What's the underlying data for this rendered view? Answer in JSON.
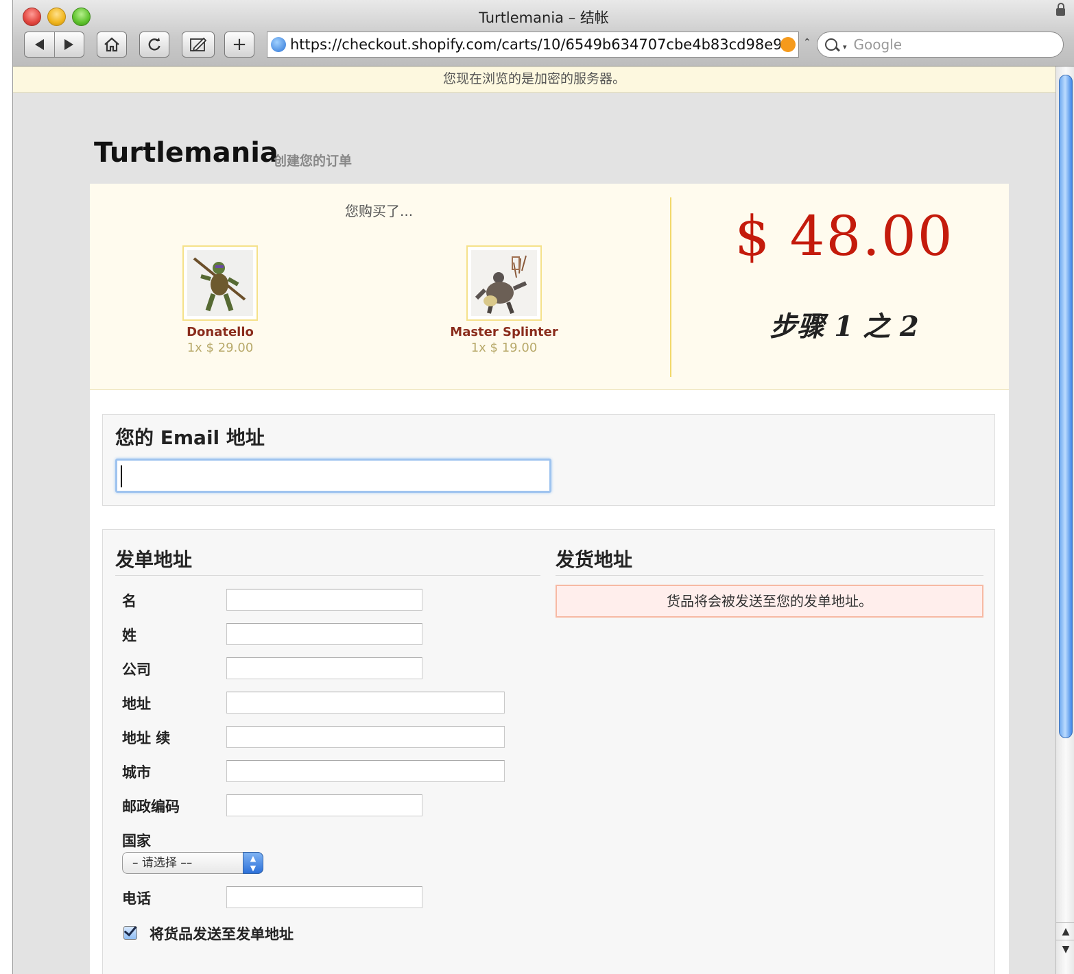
{
  "window": {
    "title": "Turtlemania – 结帐",
    "url": "https://checkout.shopify.com/carts/10/6549b634707cbe4b83cd98e9",
    "search_placeholder": "Google",
    "secure_notice": "您现在浏览的是加密的服务器。"
  },
  "store": {
    "name": "Turtlemania",
    "subtitle": "创建您的订单"
  },
  "order": {
    "bought_label": "您购买了...",
    "items": [
      {
        "name": "Donatello",
        "price": "1x $ 29.00",
        "image": "donatello-figure"
      },
      {
        "name": "Master Splinter",
        "price": "1x $ 19.00",
        "image": "master-splinter-figure"
      }
    ],
    "total": "$ 48.00",
    "step": "步骤 1 之 2"
  },
  "email": {
    "title": "您的 Email 地址",
    "value": ""
  },
  "billing": {
    "title": "发单地址",
    "fields": [
      {
        "label": "名",
        "value": ""
      },
      {
        "label": "姓",
        "value": ""
      },
      {
        "label": "公司",
        "value": ""
      },
      {
        "label": "地址",
        "value": ""
      },
      {
        "label": "地址 续",
        "value": ""
      },
      {
        "label": "城市",
        "value": ""
      },
      {
        "label": "邮政编码",
        "value": ""
      },
      {
        "label": "国家",
        "value": "– 请选择 ––"
      },
      {
        "label": "电话",
        "value": ""
      }
    ],
    "ship_same_label": "将货品发送至发单地址",
    "ship_same_checked": true
  },
  "shipping": {
    "title": "发货地址",
    "note": "货品将会被发送至您的发单地址。"
  },
  "colors": {
    "total": "#c41b0c",
    "product_name": "#8a2c1c",
    "summary_bg": "#fffbee",
    "ship_note_bg": "#ffeeec"
  }
}
